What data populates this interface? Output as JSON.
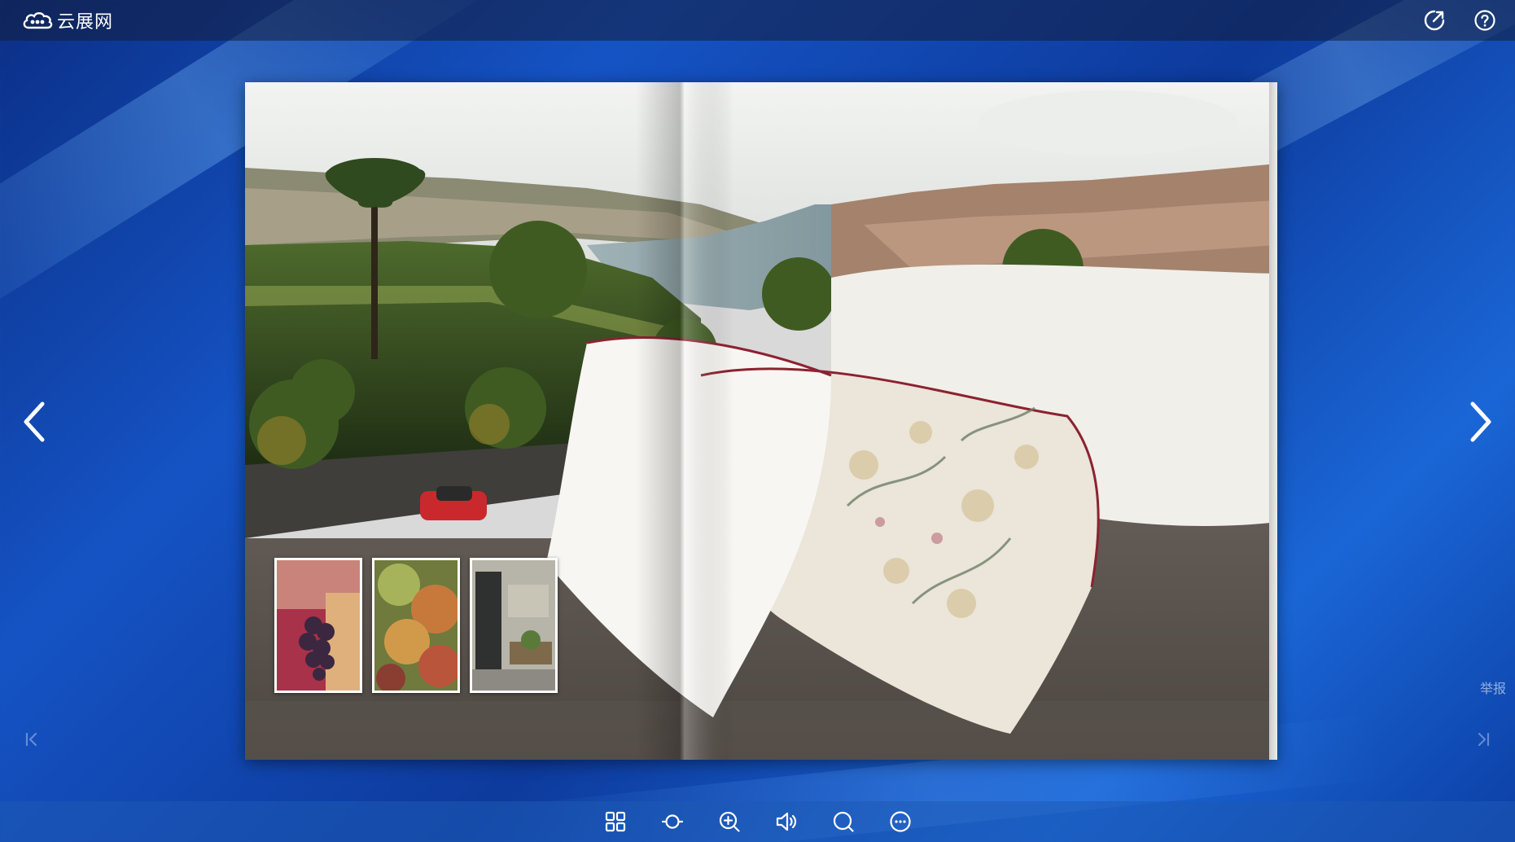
{
  "app": {
    "brand_name": "云展网",
    "logo_icon": "cloud-logo-icon"
  },
  "topbar": {
    "share_icon": "share-icon",
    "help_icon": "help-icon"
  },
  "navigation": {
    "prev_icon": "chevron-left-icon",
    "next_icon": "chevron-right-icon",
    "first_icon": "first-page-icon",
    "last_icon": "last-page-icon",
    "report_label": "举报"
  },
  "book": {
    "spread_scene": "river-city-with-pillows-photo",
    "thumbnails": [
      "grapes-photo",
      "vine-leaves-photo",
      "stone-doorway-photo"
    ]
  },
  "toolbar": {
    "items": [
      {
        "name": "thumbnails-grid-icon"
      },
      {
        "name": "autoplay-icon"
      },
      {
        "name": "zoom-in-icon"
      },
      {
        "name": "sound-icon"
      },
      {
        "name": "search-icon"
      },
      {
        "name": "more-icon"
      }
    ]
  },
  "colors": {
    "background": "#1553c4",
    "topbar": "#1e2a4a",
    "bottombar": "#2b64b8",
    "icon": "#ffffff"
  }
}
